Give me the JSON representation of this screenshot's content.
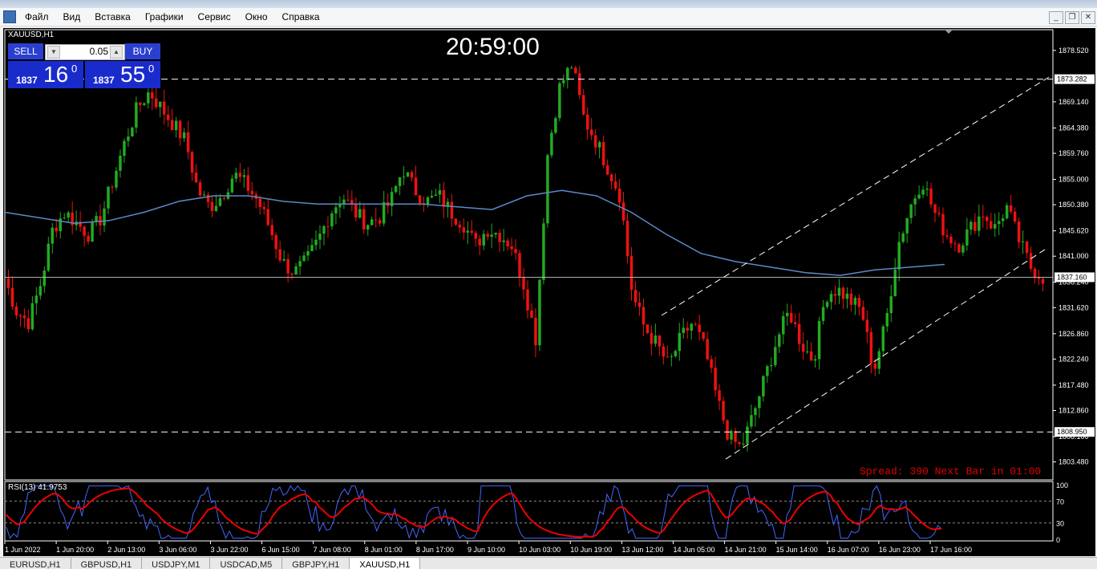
{
  "menu": [
    "Файл",
    "Вид",
    "Вставка",
    "Графики",
    "Сервис",
    "Окно",
    "Справка"
  ],
  "window_controls": [
    "_",
    "❐",
    "✕"
  ],
  "chart": {
    "symbol_label": "XAUUSD,H1",
    "clock": "20:59:00",
    "spread_text": "Spread: 390 Next Bar in 01:00",
    "current_price_label": "1837.160",
    "upper_level_label": "1873.282",
    "lower_level_label": "1808.950",
    "rsi_label": "RSI(13) 41.9753",
    "colors": {
      "bull": "#22aa22",
      "bear": "#ee1111",
      "ma": "#5a8ac8",
      "rsi_fast": "#4466ff",
      "rsi_slow": "#ee0000",
      "trade_blue": "#1a2bcc"
    }
  },
  "trade_panel": {
    "sell_label": "SELL",
    "buy_label": "BUY",
    "lot": "0.05",
    "sell_big": "1837",
    "sell_small": "16",
    "sell_sup": "0",
    "buy_big": "1837",
    "buy_small": "55",
    "buy_sup": "0"
  },
  "chart_data": {
    "type": "candlestick",
    "y_axis_ticks": [
      "1878.520",
      "1869.140",
      "1864.380",
      "1859.760",
      "1855.000",
      "1850.380",
      "1845.620",
      "1841.000",
      "1836.240",
      "1831.620",
      "1826.860",
      "1822.240",
      "1817.480",
      "1812.860",
      "1808.100",
      "1803.480"
    ],
    "x_axis_ticks": [
      "1 Jun 2022",
      "1 Jun 20:00",
      "2 Jun 13:00",
      "3 Jun 06:00",
      "3 Jun 22:00",
      "6 Jun 15:00",
      "7 Jun 08:00",
      "8 Jun 01:00",
      "8 Jun 17:00",
      "9 Jun 10:00",
      "10 Jun 03:00",
      "10 Jun 19:00",
      "13 Jun 12:00",
      "14 Jun 05:00",
      "14 Jun 21:00",
      "15 Jun 14:00",
      "16 Jun 07:00",
      "16 Jun 23:00",
      "17 Jun 16:00"
    ],
    "ylim": [
      1803.48,
      1878.52
    ],
    "close_path": [
      1837,
      1831,
      1829,
      1836,
      1846,
      1849,
      1847,
      1845,
      1848,
      1855,
      1862,
      1868,
      1871,
      1868,
      1865,
      1862,
      1853,
      1850,
      1852,
      1856,
      1854,
      1851,
      1846,
      1840,
      1838,
      1840,
      1844,
      1849,
      1852,
      1849,
      1847,
      1848,
      1851,
      1857,
      1853,
      1851,
      1852,
      1849,
      1847,
      1843,
      1846,
      1845,
      1843,
      1836,
      1826,
      1860,
      1872,
      1876,
      1866,
      1862,
      1857,
      1852,
      1834,
      1828,
      1825,
      1821,
      1826,
      1829,
      1824,
      1815,
      1808,
      1806,
      1812,
      1819,
      1826,
      1831,
      1825,
      1822,
      1834,
      1835,
      1833,
      1831,
      1820,
      1829,
      1843,
      1850,
      1855,
      1849,
      1845,
      1843,
      1846,
      1849,
      1846,
      1850,
      1844,
      1839,
      1837.16
    ],
    "moving_average": [
      1849,
      1848,
      1847,
      1847.5,
      1849,
      1851,
      1852,
      1852,
      1851,
      1850.5,
      1850.5,
      1850.5,
      1850.5,
      1850,
      1849.5,
      1852,
      1853,
      1852,
      1849,
      1845,
      1841.5,
      1840,
      1839,
      1838,
      1837.5,
      1838.5,
      1839,
      1839.5
    ]
  },
  "rsi_axis": [
    "100",
    "70",
    "30",
    "0"
  ],
  "tabs": [
    "EURUSD,H1",
    "GBPUSD,H1",
    "USDJPY,M1",
    "USDCAD,M5",
    "GBPJPY,H1",
    "XAUUSD,H1"
  ],
  "active_tab": 5
}
